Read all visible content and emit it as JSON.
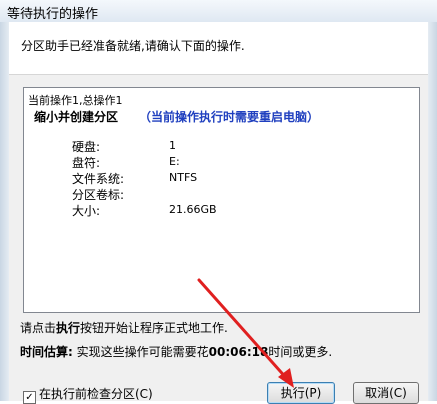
{
  "window": {
    "title": "等待执行的操作"
  },
  "header": {
    "message": "分区助手已经准备就绪,请确认下面的操作."
  },
  "operations": {
    "summary": "当前操作1,总操作1",
    "title": "缩小并创建分区",
    "note": "（当前操作执行时需要重启电脑）",
    "properties": [
      {
        "label": "硬盘:",
        "value": "1"
      },
      {
        "label": "盘符:",
        "value": "E:"
      },
      {
        "label": "文件系统:",
        "value": "NTFS"
      },
      {
        "label": "分区卷标:",
        "value": ""
      },
      {
        "label": "大小:",
        "value": "21.66GB"
      }
    ]
  },
  "hint": {
    "prefix": "请点击",
    "bold": "执行",
    "suffix": "按钮开始让程序正式地工作."
  },
  "time_estimate": {
    "label": "时间估算:",
    "prefix": " 实现这些操作可能需要花",
    "value": "00:06:18",
    "suffix": "时间或更多."
  },
  "precheck": {
    "label": "在执行前检查分区(C)",
    "checked": true,
    "check_mark": "✓"
  },
  "buttons": {
    "execute": "执行(P)",
    "cancel": "取消(C)"
  },
  "colors": {
    "note": "#1f3fbf",
    "annotation_arrow": "#e02020"
  }
}
